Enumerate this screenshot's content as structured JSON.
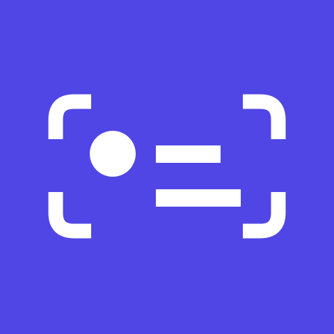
{
  "icon": {
    "name": "scan-card-icon",
    "background_color": "#5046E5",
    "foreground_color": "#FFFFFF"
  }
}
